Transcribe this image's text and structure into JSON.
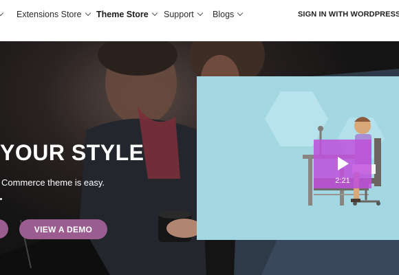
{
  "nav": {
    "items": [
      {
        "label": "Extensions Store"
      },
      {
        "label": "Theme Store"
      },
      {
        "label": "Support"
      },
      {
        "label": "Blogs"
      }
    ],
    "signin_label": "SIGN IN WITH WORDPRESS.C"
  },
  "hero": {
    "title": "YOUR STYLE",
    "subtitle": "Commerce theme is easy.",
    "demo_button_label": "VIEW A DEMO"
  },
  "video": {
    "duration": "2:21"
  },
  "colors": {
    "accent": "#9b5c8f",
    "video_bg": "#a3d8e3",
    "play_overlay": "#c050dc"
  }
}
